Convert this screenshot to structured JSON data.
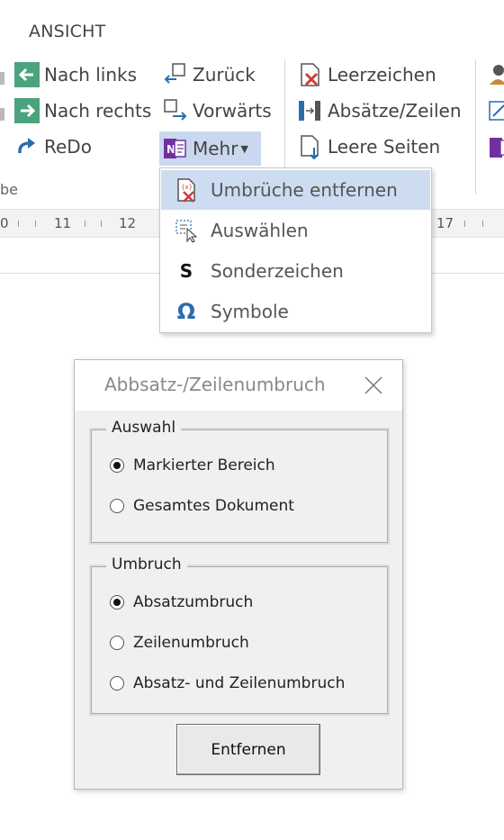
{
  "ribbon": {
    "tab": "ANSICHT",
    "group_label_partial": "be",
    "col1": [
      "Nach links",
      "Nach rechts",
      "ReDo"
    ],
    "col2": [
      "Zurück",
      "Vorwärts",
      "Mehr"
    ],
    "col3": [
      "Leerzeichen",
      "Absätze/Zeilen",
      "Leere Seiten"
    ],
    "icons": {
      "nach_links": "arrow-left-box-icon",
      "nach_rechts": "arrow-right-box-icon",
      "redo": "redo-arrow-icon",
      "zurueck": "back-copy-icon",
      "vorwaerts": "forward-copy-icon",
      "mehr": "onenote-icon",
      "leerzeichen": "remove-space-icon",
      "absaetze": "paragraph-lines-icon",
      "leere_seiten": "blank-page-icon"
    }
  },
  "ruler": {
    "ticks": [
      "0",
      "11",
      "12",
      "17"
    ]
  },
  "menu": {
    "items": [
      {
        "label": "Umbrüche entfernen",
        "icon": "remove-breaks-icon",
        "highlighted": true
      },
      {
        "label": "Auswählen",
        "icon": "select-cursor-icon"
      },
      {
        "label": "Sonderzeichen",
        "icon": "bold-s-icon",
        "glyph": "S"
      },
      {
        "label": "Symbole",
        "icon": "omega-icon",
        "glyph": "Ω"
      }
    ]
  },
  "dialog": {
    "title": "Abbsatz-/Zeilenumbruch",
    "auswahl": {
      "legend": "Auswahl",
      "options": [
        "Markierter Bereich",
        "Gesamtes Dokument"
      ],
      "selected": 0
    },
    "umbruch": {
      "legend": "Umbruch",
      "options": [
        "Absatzumbruch",
        "Zeilenumbruch",
        "Absatz- und Zeilenumbruch"
      ],
      "selected": 0
    },
    "button": "Entfernen"
  },
  "colors": {
    "accent_blue": "#2b6cb0",
    "green": "#4aa37c",
    "purple": "#7030a0",
    "red": "#d23a3a",
    "menu_highlight": "#cddcf1"
  }
}
